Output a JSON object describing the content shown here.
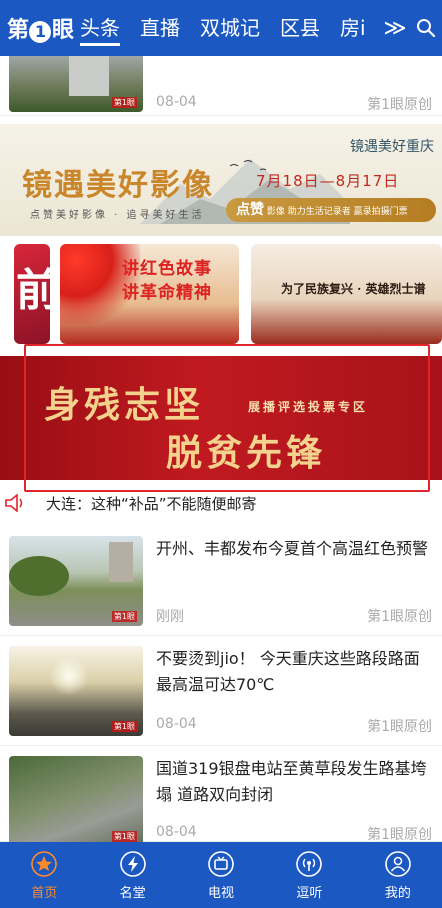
{
  "header": {
    "logo": {
      "prefix": "第",
      "num": "1",
      "suffix": "眼"
    },
    "tabs": [
      {
        "label": "头条",
        "active": true
      },
      {
        "label": "直播"
      },
      {
        "label": "双城记"
      },
      {
        "label": "区县"
      },
      {
        "label": "房i"
      }
    ],
    "more_glyph": "≫"
  },
  "feed_top": {
    "date": "08-04",
    "source": "第1眼原创"
  },
  "banner_photo": {
    "title": "镜遇美好影像",
    "subtitle": "点赞美好影像 · 追寻美好生活",
    "right_title": "镜遇美好重庆",
    "date_range": "7月18日—8月17日",
    "pill_strong": "点赞",
    "pill_text": "影像 助力生活记录者 赢录拍摄门票"
  },
  "carousel": {
    "card1_char": "前",
    "card2_lines": [
      "讲红色故事",
      "讲革命精神"
    ],
    "card3_text": "为了民族复兴 · 英雄烈士谱"
  },
  "banner_red": {
    "line1": "身残志坚",
    "line2": "脱贫先锋",
    "tag": "展播评选投票专区"
  },
  "ticker": {
    "text": "大连：这种“补品”不能随便邮寄"
  },
  "feed": [
    {
      "title": "开州、丰都发布今夏首个高温红色预警",
      "time": "刚刚",
      "source": "第1眼原创"
    },
    {
      "title": "不要烫到jio！ 今天重庆这些路段路面最高温可达70℃",
      "time": "08-04",
      "source": "第1眼原创"
    },
    {
      "title": "国道319银盘电站至黄草段发生路基垮塌 道路双向封闭",
      "time": "08-04",
      "source": "第1眼原创"
    }
  ],
  "bottom_nav": [
    {
      "label": "首页",
      "icon": "star-icon",
      "active": true
    },
    {
      "label": "名堂",
      "icon": "lightning-icon"
    },
    {
      "label": "电视",
      "icon": "tv-icon"
    },
    {
      "label": "逗听",
      "icon": "radio-icon"
    },
    {
      "label": "我的",
      "icon": "user-icon"
    }
  ],
  "colors": {
    "primary": "#1c58c2",
    "active": "#ff8a2a",
    "highlight_frame": "#e0262b"
  }
}
